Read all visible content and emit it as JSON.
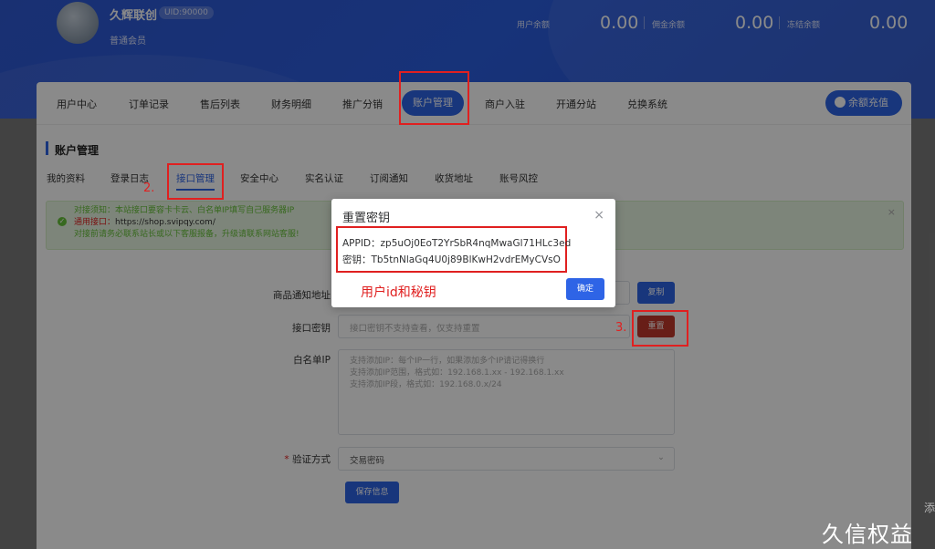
{
  "header": {
    "username": "久辉联创",
    "uid": "UID:90000",
    "level": "普通会员",
    "balances": [
      {
        "label": "用户余额",
        "value": "0.00"
      },
      {
        "label": "佣金余额",
        "value": "0.00"
      },
      {
        "label": "冻结余额",
        "value": "0.00"
      }
    ]
  },
  "nav": {
    "items": [
      "用户中心",
      "订单记录",
      "售后列表",
      "财务明细",
      "推广分销",
      "账户管理",
      "商户入驻",
      "开通分站",
      "兑换系统"
    ],
    "active_index": 5,
    "recharge_label": "余额充值"
  },
  "section": {
    "title": "账户管理"
  },
  "subtabs": {
    "items": [
      "我的资料",
      "登录日志",
      "接口管理",
      "安全中心",
      "实名认证",
      "订阅通知",
      "收货地址",
      "账号风控"
    ],
    "active_index": 2
  },
  "notice": {
    "line1": "对接须知：本站接口要容卡卡云、白名单IP填写自己服务器IP",
    "line2_label": "通用接口：",
    "line2_value": "https://shop.svipqy.com/",
    "line3": "对接前请务必联系站长或以下客服报备，升级请联系网站客服!"
  },
  "form": {
    "notify_label": "商品通知地址",
    "copy_label": "复制",
    "key_label": "接口密钥",
    "key_placeholder": "接口密钥不支持查看，仅支持重置",
    "reset_label": "重置",
    "whitelist_label": "白名单IP",
    "whitelist_hint1": "支持添加IP：每个IP一行，如果添加多个IP请记得换行",
    "whitelist_hint2": "支持添加IP范围，格式如：192.168.1.xx - 192.168.1.xx",
    "whitelist_hint3": "支持添加IP段，格式如：192.168.0.x/24",
    "verify_required": "*",
    "verify_label": "验证方式",
    "verify_value": "交易密码",
    "save_label": "保存信息"
  },
  "modal": {
    "title": "重置密钥",
    "appid_line": "APPID：zp5uOj0EoT2YrSbR4nqMwaGl71HLc3ed",
    "secret_line": "密钥：Tb5tnNlaGq4U0j89BlKwH2vdrEMyCVsO",
    "confirm_label": "确定"
  },
  "annotations": {
    "note": "用户id和秘钥",
    "step2": "2.",
    "step3": "3."
  },
  "watermark": "久信权益",
  "watermark_side": "添",
  "colors": {
    "primary": "#2e64e6",
    "danger": "#c0392b",
    "annotation": "#e02020",
    "success": "#67c23a"
  }
}
